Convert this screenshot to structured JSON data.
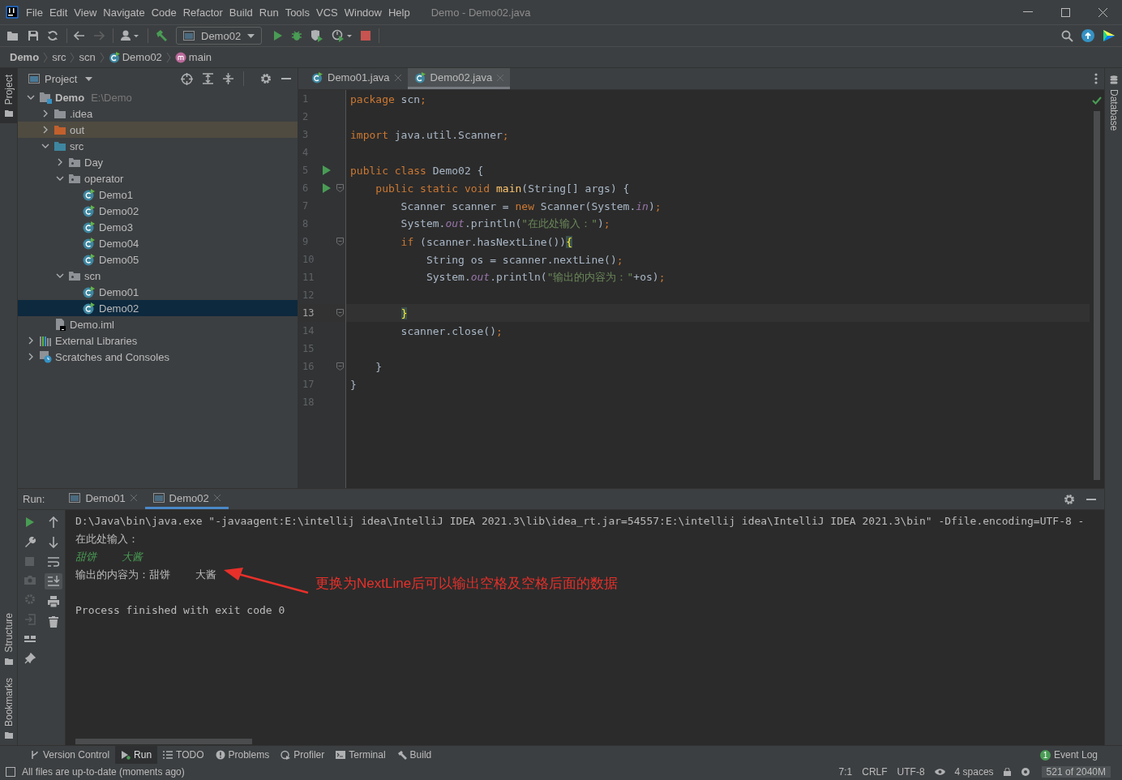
{
  "window": {
    "title": "Demo - Demo02.java"
  },
  "menu": [
    "File",
    "Edit",
    "View",
    "Navigate",
    "Code",
    "Refactor",
    "Build",
    "Run",
    "Tools",
    "VCS",
    "Window",
    "Help"
  ],
  "toolbar": {
    "run_config": "Demo02"
  },
  "breadcrumb": [
    {
      "label": "Demo",
      "kind": "project"
    },
    {
      "label": "src",
      "kind": "folder"
    },
    {
      "label": "scn",
      "kind": "folder"
    },
    {
      "label": "Demo02",
      "kind": "class"
    },
    {
      "label": "main",
      "kind": "method"
    }
  ],
  "left_stripe": [
    {
      "label": "Project",
      "selected": true
    },
    {
      "label": "Structure",
      "selected": false
    },
    {
      "label": "Bookmarks",
      "selected": false
    }
  ],
  "right_stripe": {
    "label": "Database"
  },
  "project_panel": {
    "title": "Project",
    "tree": [
      {
        "label": "Demo",
        "note": "E:\\Demo",
        "kind": "module",
        "expanded": true,
        "selected": false,
        "children": [
          {
            "label": ".idea",
            "kind": "folder",
            "expanded": false,
            "selected": false
          },
          {
            "label": "out",
            "kind": "excluded",
            "expanded": false,
            "selected": false
          },
          {
            "label": "src",
            "kind": "source",
            "expanded": true,
            "selected": false,
            "children": [
              {
                "label": "Day",
                "kind": "package",
                "expanded": false,
                "selected": false
              },
              {
                "label": "operator",
                "kind": "package",
                "expanded": true,
                "selected": false,
                "children": [
                  {
                    "label": "Demo1",
                    "kind": "class",
                    "selected": false
                  },
                  {
                    "label": "Demo02",
                    "kind": "class",
                    "selected": false
                  },
                  {
                    "label": "Demo3",
                    "kind": "class",
                    "selected": false
                  },
                  {
                    "label": "Demo04",
                    "kind": "class",
                    "selected": false
                  },
                  {
                    "label": "Demo05",
                    "kind": "class",
                    "selected": false
                  }
                ]
              },
              {
                "label": "scn",
                "kind": "package",
                "expanded": true,
                "selected": false,
                "children": [
                  {
                    "label": "Demo01",
                    "kind": "class",
                    "selected": false
                  },
                  {
                    "label": "Demo02",
                    "kind": "class",
                    "selected": true
                  }
                ]
              }
            ]
          },
          {
            "label": "Demo.iml",
            "kind": "iml",
            "selected": false
          }
        ]
      },
      {
        "label": "External Libraries",
        "kind": "libraries",
        "expanded": false,
        "selected": false
      },
      {
        "label": "Scratches and Consoles",
        "kind": "scratches",
        "expanded": false,
        "selected": false
      }
    ]
  },
  "editor": {
    "tabs": [
      {
        "label": "Demo01.java",
        "selected": false
      },
      {
        "label": "Demo02.java",
        "selected": true
      }
    ],
    "lines": [
      {
        "number": "1",
        "runnable": false,
        "foldable": false,
        "current": false,
        "tokens": [
          {
            "t": "package",
            "kind": "keyword"
          },
          {
            "t": " scn",
            "kind": "text"
          },
          {
            "t": ";",
            "kind": "keyword"
          }
        ]
      },
      {
        "number": "2",
        "runnable": false,
        "foldable": false,
        "current": false
      },
      {
        "number": "3",
        "runnable": false,
        "foldable": false,
        "current": false,
        "tokens": [
          {
            "t": "import",
            "kind": "keyword"
          },
          {
            "t": " java.util.Scanner",
            "kind": "text"
          },
          {
            "t": ";",
            "kind": "keyword"
          }
        ]
      },
      {
        "number": "4",
        "runnable": false,
        "foldable": false,
        "current": false
      },
      {
        "number": "5",
        "runnable": true,
        "foldable": false,
        "current": false,
        "tokens": [
          {
            "t": "public class",
            "kind": "keyword"
          },
          {
            "t": " Demo02 {",
            "kind": "text"
          }
        ]
      },
      {
        "number": "6",
        "runnable": true,
        "foldable": true,
        "current": false,
        "tokens": [
          {
            "t": "    public static void",
            "kind": "keyword"
          },
          {
            "t": " main",
            "kind": "method"
          },
          {
            "t": "(String[] args) {",
            "kind": "text"
          }
        ]
      },
      {
        "number": "7",
        "runnable": false,
        "foldable": false,
        "current": false,
        "tokens": [
          {
            "t": "        Scanner scanner = ",
            "kind": "text"
          },
          {
            "t": "new",
            "kind": "keyword"
          },
          {
            "t": " Scanner(System.",
            "kind": "text"
          },
          {
            "t": "in",
            "kind": "field"
          },
          {
            "t": ")",
            "kind": "text"
          },
          {
            "t": ";",
            "kind": "keyword"
          }
        ]
      },
      {
        "number": "8",
        "runnable": false,
        "foldable": false,
        "current": false,
        "tokens": [
          {
            "t": "        System.",
            "kind": "text"
          },
          {
            "t": "out",
            "kind": "field"
          },
          {
            "t": ".println(",
            "kind": "text"
          },
          {
            "t": "\"在此处输入：\"",
            "kind": "string"
          },
          {
            "t": ")",
            "kind": "text"
          },
          {
            "t": ";",
            "kind": "keyword"
          }
        ]
      },
      {
        "number": "9",
        "runnable": false,
        "foldable": true,
        "current": false,
        "tokens": [
          {
            "t": "        if",
            "kind": "keyword"
          },
          {
            "t": " (scanner.hasNextLine())",
            "kind": "text"
          },
          {
            "t": "{",
            "kind": "brace_match"
          }
        ]
      },
      {
        "number": "10",
        "runnable": false,
        "foldable": false,
        "current": false,
        "tokens": [
          {
            "t": "            String os = scanner.nextLine()",
            "kind": "text"
          },
          {
            "t": ";",
            "kind": "keyword"
          }
        ]
      },
      {
        "number": "11",
        "runnable": false,
        "foldable": false,
        "current": false,
        "tokens": [
          {
            "t": "            System.",
            "kind": "text"
          },
          {
            "t": "out",
            "kind": "field"
          },
          {
            "t": ".println(",
            "kind": "text"
          },
          {
            "t": "\"输出的内容为：\"",
            "kind": "string"
          },
          {
            "t": "+os)",
            "kind": "text"
          },
          {
            "t": ";",
            "kind": "keyword"
          }
        ]
      },
      {
        "number": "12",
        "runnable": false,
        "foldable": false,
        "current": false
      },
      {
        "number": "13",
        "runnable": false,
        "foldable": true,
        "current": true,
        "tokens": [
          {
            "t": "        }",
            "kind": "brace_match"
          }
        ]
      },
      {
        "number": "14",
        "runnable": false,
        "foldable": false,
        "current": false,
        "tokens": [
          {
            "t": "        scanner.close()",
            "kind": "text"
          },
          {
            "t": ";",
            "kind": "keyword"
          }
        ]
      },
      {
        "number": "15",
        "runnable": false,
        "foldable": false,
        "current": false
      },
      {
        "number": "16",
        "runnable": false,
        "foldable": true,
        "current": false,
        "tokens": [
          {
            "t": "    }",
            "kind": "text"
          }
        ]
      },
      {
        "number": "17",
        "runnable": false,
        "foldable": false,
        "current": false,
        "tokens": [
          {
            "t": "}",
            "kind": "text"
          }
        ]
      },
      {
        "number": "18",
        "runnable": false,
        "foldable": false,
        "current": false
      }
    ]
  },
  "run_panel": {
    "label": "Run:",
    "tabs": [
      {
        "label": "Demo01",
        "selected": false
      },
      {
        "label": "Demo02",
        "selected": true
      }
    ],
    "console": [
      {
        "kind": "command",
        "text": "D:\\Java\\bin\\java.exe \"-javaagent:E:\\intellij idea\\IntelliJ IDEA 2021.3\\lib\\idea_rt.jar=54557:E:\\intellij idea\\IntelliJ IDEA 2021.3\\bin\" -Dfile.encoding=UTF-8 -"
      },
      {
        "kind": "output",
        "text": "在此处输入："
      },
      {
        "kind": "input",
        "text": "甜饼    大酱"
      },
      {
        "kind": "output",
        "text": "输出的内容为：甜饼    大酱"
      },
      {
        "kind": "exit",
        "text": "Process finished with exit code 0"
      }
    ],
    "annotation": "更换为NextLine后可以输出空格及空格后面的数据"
  },
  "tool_windows": [
    {
      "label": "Version Control",
      "kind": "vcs",
      "selected": false
    },
    {
      "label": "Run",
      "kind": "run",
      "selected": true
    },
    {
      "label": "TODO",
      "kind": "todo",
      "selected": false
    },
    {
      "label": "Problems",
      "kind": "problems",
      "selected": false
    },
    {
      "label": "Profiler",
      "kind": "profiler",
      "selected": false
    },
    {
      "label": "Terminal",
      "kind": "terminal",
      "selected": false
    },
    {
      "label": "Build",
      "kind": "build",
      "selected": false
    }
  ],
  "event_log": {
    "label": "Event Log",
    "count": "1"
  },
  "status_bar": {
    "message": "All files are up-to-date (moments ago)",
    "position": "7:1",
    "line_separator": "CRLF",
    "encoding": "UTF-8",
    "indent": "4 spaces",
    "memory": "521 of 2040M"
  }
}
